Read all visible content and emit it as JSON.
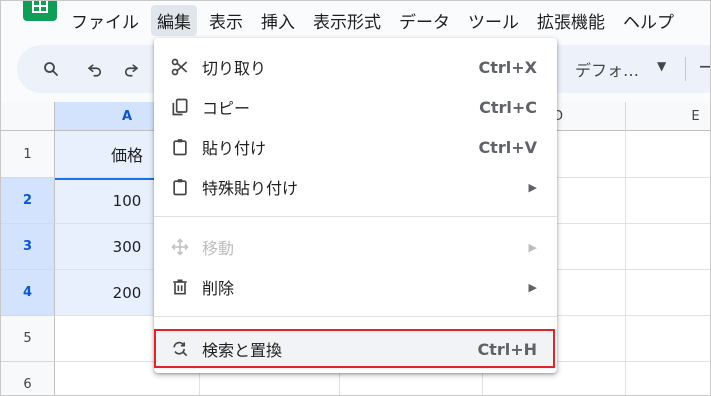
{
  "menubar": {
    "items": [
      {
        "label": "ファイル"
      },
      {
        "label": "編集"
      },
      {
        "label": "表示"
      },
      {
        "label": "挿入"
      },
      {
        "label": "表示形式"
      },
      {
        "label": "データ"
      },
      {
        "label": "ツール"
      },
      {
        "label": "拡張機能"
      },
      {
        "label": "ヘルプ"
      }
    ]
  },
  "toolbar": {
    "font": "デフォ…"
  },
  "grid": {
    "columns": [
      "A",
      "",
      "",
      "",
      "E"
    ],
    "rows": [
      "1",
      "2",
      "3",
      "4",
      "5",
      "6"
    ],
    "cells_a": [
      "価格",
      "100",
      "300",
      "200",
      "",
      ""
    ],
    "col_d_partial": "D"
  },
  "edit_menu": {
    "items": [
      {
        "label": "切り取り",
        "shortcut": "Ctrl+X",
        "icon": "scissors-icon"
      },
      {
        "label": "コピー",
        "shortcut": "Ctrl+C",
        "icon": "copy-icon"
      },
      {
        "label": "貼り付け",
        "shortcut": "Ctrl+V",
        "icon": "paste-icon"
      },
      {
        "label": "特殊貼り付け",
        "submenu_arrow": "▶",
        "icon": "paste-special-icon"
      },
      {
        "label": "移動",
        "submenu_arrow": "▶",
        "icon": "move-icon",
        "disabled": true
      },
      {
        "label": "削除",
        "submenu_arrow": "▶",
        "icon": "trash-icon"
      },
      {
        "label": "検索と置換",
        "shortcut": "Ctrl+H",
        "icon": "find-replace-icon",
        "highlighted": true
      }
    ]
  },
  "colors": {
    "highlight_box": "#e0242b",
    "selection": "#d3e3fd",
    "sheets_green": "#0f9d58"
  }
}
